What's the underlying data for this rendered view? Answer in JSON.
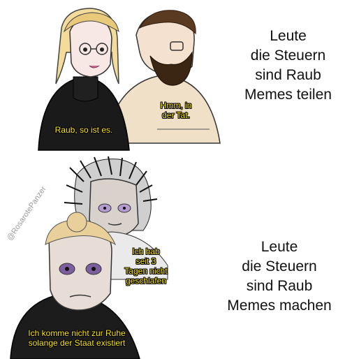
{
  "top_panel": {
    "right_text": "Leute\ndie Steuern\nsind Raub\nMemes teilen",
    "caption_woman": "Raub, so ist es.",
    "caption_man": "Hmm, in\nder Tat."
  },
  "bottom_panel": {
    "right_text": "Leute\ndie Steuern\nsind Raub\nMemes machen",
    "caption_tired": "Ich hab\nseit 3\nTagen nicht\ngeschlafen",
    "caption_front": "Ich komme nicht zur Ruhe\nsolange der Staat existiert",
    "watermark": "@RosarotePanzer"
  },
  "colors": {
    "caption_fill": "#ffe600",
    "caption_outline": "#000000",
    "text": "#111111",
    "background": "#ffffff"
  }
}
